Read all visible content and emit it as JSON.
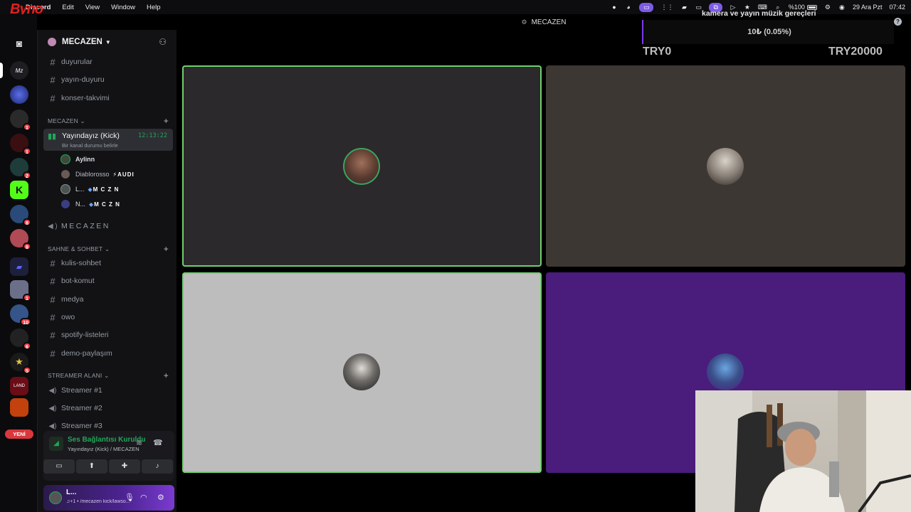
{
  "menubar": {
    "app_name": "Discord",
    "items": [
      "Edit",
      "View",
      "Window",
      "Help"
    ],
    "right": {
      "battery": "%100",
      "date": "29 Ara Pzt",
      "time": "07:42"
    }
  },
  "stream_logo": "Byno",
  "titlebar": {
    "title": "MECAZEN"
  },
  "rail": {
    "servers": [
      {
        "name": "discord-home",
        "badge": ""
      },
      {
        "name": "mecazen",
        "badge": ""
      },
      {
        "name": "server-3",
        "badge": ""
      },
      {
        "name": "server-4",
        "badge": "1"
      },
      {
        "name": "server-5",
        "badge": "1"
      },
      {
        "name": "server-6",
        "badge": "2"
      },
      {
        "name": "kick",
        "badge": ""
      },
      {
        "name": "server-8",
        "badge": "8"
      },
      {
        "name": "server-9",
        "badge": "8"
      },
      {
        "name": "folder",
        "badge": ""
      },
      {
        "name": "server-11",
        "badge": "1"
      },
      {
        "name": "server-12",
        "badge": "10"
      },
      {
        "name": "server-13",
        "badge": "6"
      },
      {
        "name": "server-14",
        "badge": "5"
      },
      {
        "name": "server-land",
        "badge": ""
      },
      {
        "name": "server-16",
        "badge": ""
      }
    ],
    "new_label": "YENİ"
  },
  "sidebar": {
    "server_name": "MECAZEN",
    "top_channels": [
      "duyurular",
      "yayın-duyuru",
      "konser-takvimi"
    ],
    "category_mecazen": "MECAZEN",
    "active_channel": {
      "name": "Yayındayız (Kick)",
      "timer": "12:13:22",
      "status": "Bir kanal durumu belirle"
    },
    "members": [
      {
        "name": "Aylinn",
        "tag": ""
      },
      {
        "name": "Diablorosso",
        "tag": "AUDI"
      },
      {
        "name": "L...",
        "tag": "M C Z N"
      },
      {
        "name": "N...",
        "tag": "M C Z N"
      }
    ],
    "voice_mecazen": "MECAZEN",
    "category_sahne": "SAHNE & SOHBET",
    "sahne_channels": [
      "kulis-sohbet",
      "bot-komut",
      "medya",
      "owo",
      "spotify-listeleri",
      "demo-paylaşım"
    ],
    "category_streamer": "STREAMER ALANI",
    "streamer_channels": [
      "Streamer #1",
      "Streamer #2",
      "Streamer #3"
    ]
  },
  "voice_panel": {
    "title": "Ses Bağlantısı Kuruldu",
    "subtitle": "Yayındayız (Kick) / MECAZEN"
  },
  "user": {
    "name": "L...",
    "status": "♫+1 • /mecazen kick/lawso..."
  },
  "overlay": {
    "title": "kamera ve yayın müzik gereçleri",
    "amount": "10₺ (0.05%)",
    "min": "TRY0",
    "max": "TRY20000"
  },
  "colors": {
    "accent_green": "#23a55a",
    "speaking_outline": "#6fd06f",
    "sidebar_bg": "#121214",
    "rail_bg": "#0b0b0d",
    "tile_dark": "#2b292c",
    "tile_brown": "#3d3733",
    "tile_gray": "#bdbdbd",
    "tile_purple": "#4a1c7c"
  }
}
